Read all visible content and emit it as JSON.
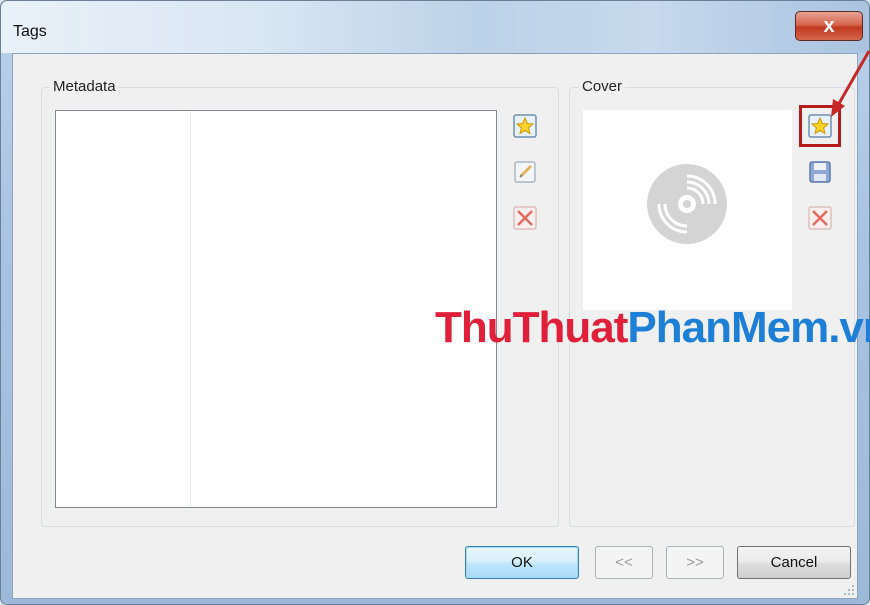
{
  "window": {
    "title": "Tags",
    "close_glyph": "x"
  },
  "metadata": {
    "label": "Metadata",
    "tools": [
      {
        "name": "add-tag-icon"
      },
      {
        "name": "edit-tag-icon"
      },
      {
        "name": "remove-tag-icon"
      }
    ]
  },
  "cover": {
    "label": "Cover",
    "placeholder_icon": "disc-icon",
    "tools": [
      {
        "name": "add-cover-icon"
      },
      {
        "name": "save-cover-icon"
      },
      {
        "name": "remove-cover-icon"
      }
    ]
  },
  "watermark": {
    "part1": "ThuThuat",
    "part2": "PhanMem.vn"
  },
  "buttons": {
    "ok": "OK",
    "prev": "<<",
    "next": ">>",
    "cancel": "Cancel"
  },
  "colors": {
    "highlight": "#b71c1c",
    "watermark_red": "#e0203a",
    "watermark_blue": "#1e7fd6",
    "arrow": "#c62828"
  }
}
